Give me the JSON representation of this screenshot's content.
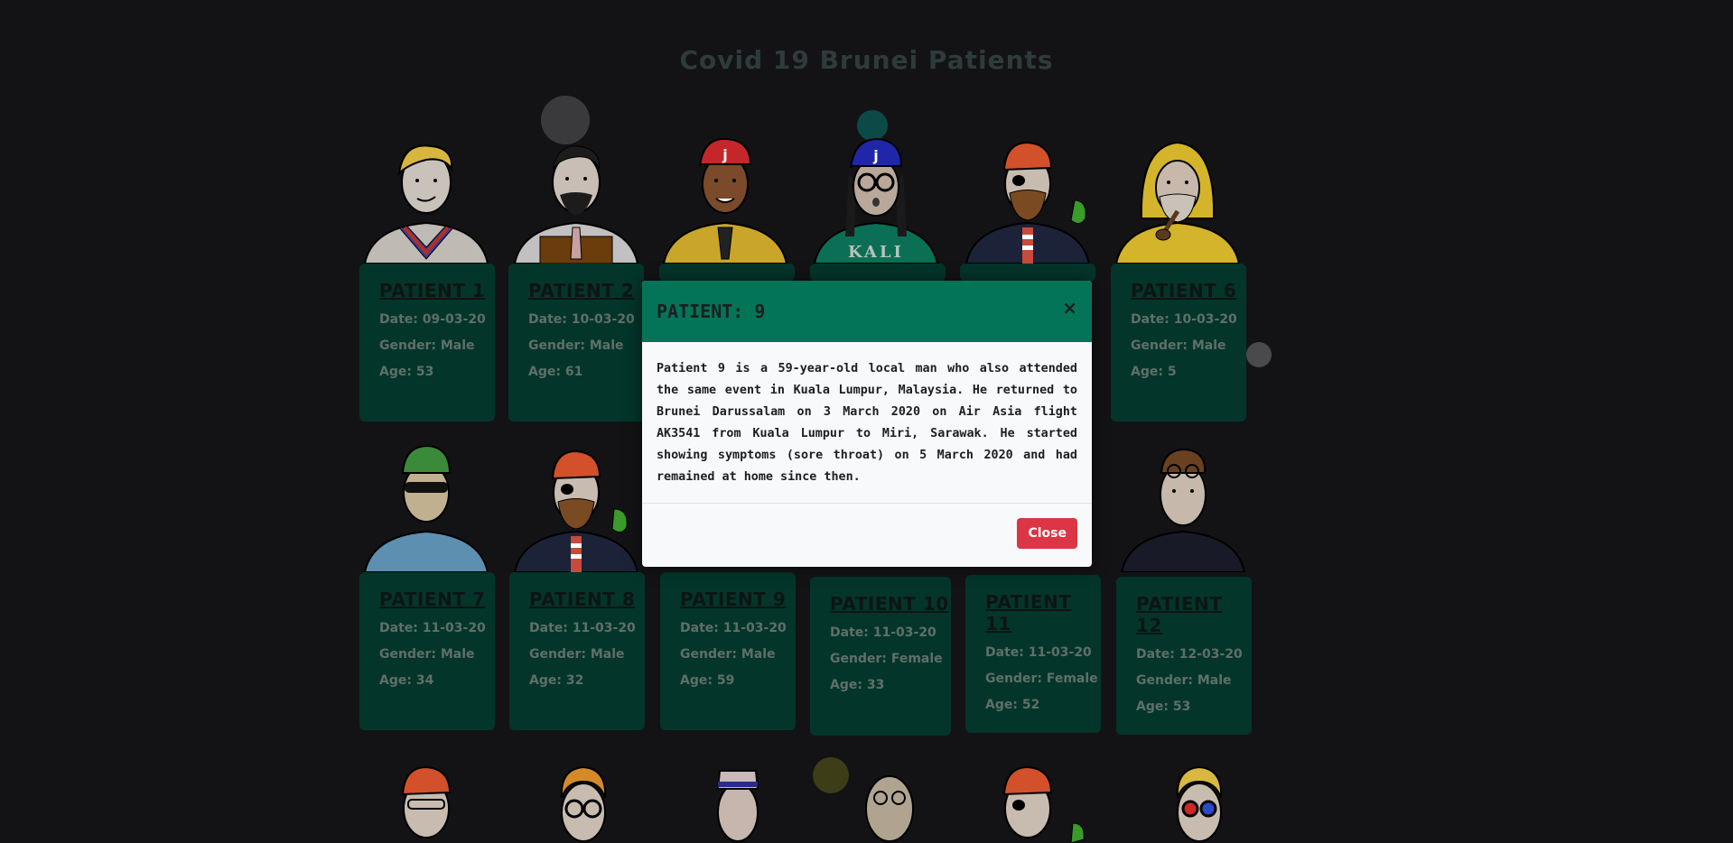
{
  "page": {
    "title": "Covid 19 Brunei Patients"
  },
  "patients": [
    {
      "name": "PATIENT 1",
      "date": "Date: 09-03-20",
      "gender": "Gender: Male",
      "age": "Age: 53"
    },
    {
      "name": "PATIENT 2",
      "date": "Date: 10-03-20",
      "gender": "Gender: Male",
      "age": "Age: 61"
    },
    {
      "name": "PATIENT 6",
      "date": "Date: 10-03-20",
      "gender": "Gender: Male",
      "age": "Age: 5"
    },
    {
      "name": "PATIENT 7",
      "date": "Date: 11-03-20",
      "gender": "Gender: Male",
      "age": "Age: 34"
    },
    {
      "name": "PATIENT 8",
      "date": "Date: 11-03-20",
      "gender": "Gender: Male",
      "age": "Age: 32"
    },
    {
      "name": "PATIENT 9",
      "date": "Date: 11-03-20",
      "gender": "Gender: Male",
      "age": "Age: 59"
    },
    {
      "name": "PATIENT 10",
      "date": "Date: 11-03-20",
      "gender": "Gender: Female",
      "age": "Age: 33"
    },
    {
      "name": "PATIENT 11",
      "date": "Date: 11-03-20",
      "gender": "Gender: Female",
      "age": "Age: 52"
    },
    {
      "name": "PATIENT 12",
      "date": "Date: 12-03-20",
      "gender": "Gender: Male",
      "age": "Age: 53"
    }
  ],
  "avatar_labels": {
    "cap_letter": "j",
    "shirt_text": "KALI"
  },
  "modal": {
    "title": "PATIENT: 9",
    "close_x": "×",
    "body": "Patient 9 is a 59-year-old local man who also attended the same event in Kuala Lumpur, Malaysia. He returned to Brunei Darussalam on 3 March 2020 on Air Asia flight AK3541 from Kuala Lumpur to Miri, Sarawak. He started showing symptoms (sore throat) on 5 March 2020 and had remained at home since then.",
    "close_button": "Close"
  },
  "colors": {
    "background": "#131316",
    "card": "#04352a",
    "modal_header": "#047458",
    "close_button": "#dc3545"
  }
}
